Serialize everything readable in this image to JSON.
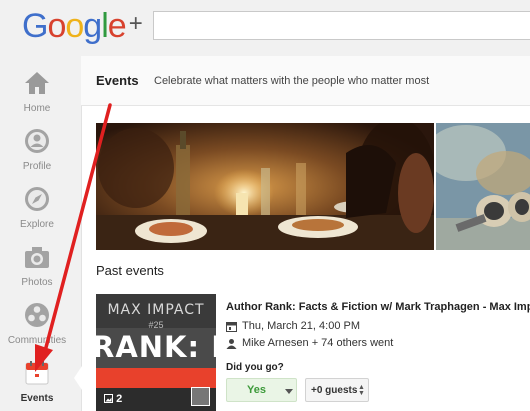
{
  "brand": {
    "logo_word": "Google",
    "logo_plus": "+"
  },
  "search": {
    "value": ""
  },
  "sidebar": {
    "items": [
      {
        "label": "Home",
        "icon": "home-icon"
      },
      {
        "label": "Profile",
        "icon": "profile-icon"
      },
      {
        "label": "Explore",
        "icon": "compass-icon"
      },
      {
        "label": "Photos",
        "icon": "camera-icon"
      },
      {
        "label": "Communities",
        "icon": "communities-icon"
      },
      {
        "label": "Events",
        "icon": "calendar-icon",
        "active": true
      }
    ]
  },
  "header": {
    "title": "Events",
    "tagline": "Celebrate what matters with the people who matter most"
  },
  "past_events_label": "Past events",
  "event": {
    "thumb_top": "MAX IMPACT",
    "thumb_number": "#25",
    "thumb_big": "RANK: FACTS",
    "photo_count": "2",
    "title": "Author Rank: Facts & Fiction w/ Mark Traphagen - Max Imp",
    "date": "Thu, March 21, 4:00 PM",
    "attendees": "Mike Arnesen + 74 others went",
    "question": "Did you go?",
    "rsvp_value": "Yes",
    "guests_value": "+0 guests"
  },
  "colors": {
    "accent_red": "#e02020",
    "yes_green": "#3d9a3a",
    "calendar_red": "#e8412c"
  }
}
